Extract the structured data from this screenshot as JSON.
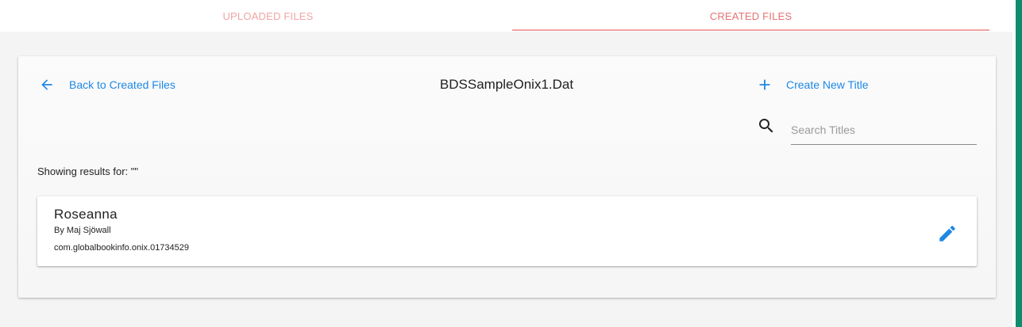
{
  "tabs": {
    "uploaded_label": "UPLOADED FILES",
    "created_label": "CREATED FILES",
    "active": "created"
  },
  "header": {
    "back_label": "Back to Created Files",
    "file_name": "BDSSampleOnix1.Dat",
    "create_label": "Create New Title"
  },
  "search": {
    "placeholder": "Search Titles",
    "value": ""
  },
  "results": {
    "summary": "Showing results for: \"\""
  },
  "titles": [
    {
      "name": "Roseanna",
      "author": "By Maj Sjöwall",
      "record_id": "com.globalbookinfo.onix.01734529"
    }
  ],
  "icons": {
    "back": "arrow-left-icon",
    "create": "plus-icon",
    "search": "search-icon",
    "edit": "pencil-icon"
  },
  "colors": {
    "accent_blue": "#1e88e5",
    "tab_text": "#e57373",
    "tab_indicator": "#f3a1a1",
    "side_accent": "#0f8c6c"
  }
}
